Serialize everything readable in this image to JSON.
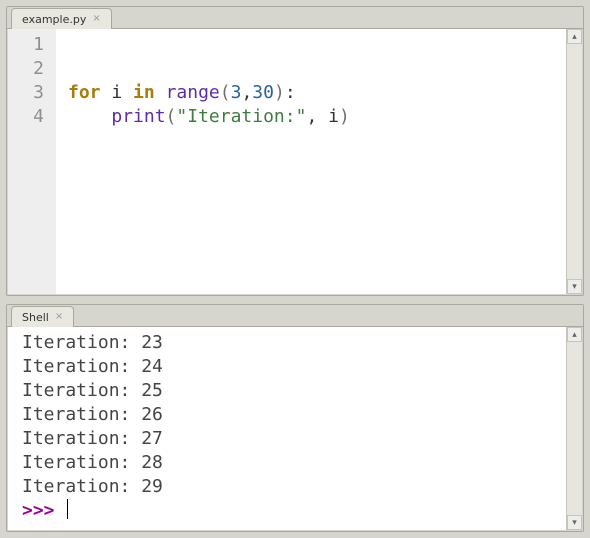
{
  "editor": {
    "tab_label": "example.py",
    "current_line": 2,
    "lines": [
      {
        "n": 1,
        "tokens": []
      },
      {
        "n": 2,
        "tokens": []
      },
      {
        "n": 3,
        "tokens": [
          {
            "t": "for ",
            "c": "kw"
          },
          {
            "t": "i ",
            "c": ""
          },
          {
            "t": "in ",
            "c": "kw"
          },
          {
            "t": "range",
            "c": "fn"
          },
          {
            "t": "(",
            "c": "paren"
          },
          {
            "t": "3",
            "c": "num"
          },
          {
            "t": ",",
            "c": ""
          },
          {
            "t": "30",
            "c": "num"
          },
          {
            "t": ")",
            "c": "paren"
          },
          {
            "t": ":",
            "c": ""
          }
        ]
      },
      {
        "n": 4,
        "tokens": [
          {
            "t": "    ",
            "c": ""
          },
          {
            "t": "print",
            "c": "fn"
          },
          {
            "t": "(",
            "c": "paren"
          },
          {
            "t": "\"Iteration:\"",
            "c": "str"
          },
          {
            "t": ", i",
            "c": ""
          },
          {
            "t": ")",
            "c": "paren"
          }
        ]
      }
    ]
  },
  "shell": {
    "tab_label": "Shell",
    "output_lines": [
      "Iteration: 23",
      "Iteration: 24",
      "Iteration: 25",
      "Iteration: 26",
      "Iteration: 27",
      "Iteration: 28",
      "Iteration: 29"
    ],
    "prompt": ">>> "
  },
  "colors": {
    "keyword": "#a77d0c",
    "function": "#5e2ca5",
    "number": "#2a6496",
    "string": "#3f7c3f",
    "prompt": "#9a009a",
    "gutter_bg": "#eeeeee",
    "frame_bg": "#d6d6ce"
  }
}
